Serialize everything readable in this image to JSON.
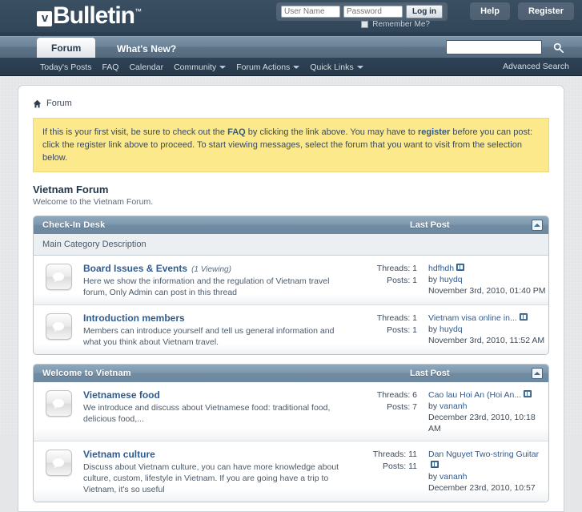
{
  "header": {
    "logo_text": "Bulletin",
    "logo_mark": "v",
    "logo_tm": "™",
    "login": {
      "username_placeholder": "User Name",
      "password_placeholder": "Password",
      "login_button": "Log in",
      "remember_label": "Remember Me?"
    },
    "help_button": "Help",
    "register_button": "Register"
  },
  "nav": {
    "tabs": [
      {
        "label": "Forum",
        "active": true
      },
      {
        "label": "What's New?",
        "active": false
      }
    ],
    "links": [
      {
        "label": "Today's Posts",
        "dropdown": false
      },
      {
        "label": "FAQ",
        "dropdown": false
      },
      {
        "label": "Calendar",
        "dropdown": false
      },
      {
        "label": "Community",
        "dropdown": true
      },
      {
        "label": "Forum Actions",
        "dropdown": true
      },
      {
        "label": "Quick Links",
        "dropdown": true
      }
    ],
    "advanced_search": "Advanced Search",
    "search_value": ""
  },
  "breadcrumb": {
    "label": "Forum"
  },
  "notice": {
    "part1": "If this is your first visit, be sure to check out the ",
    "faq": "FAQ",
    "part2": " by clicking the link above. You may have to ",
    "register": "register",
    "part3": " before you can post: click the register link above to proceed. To start viewing messages, select the forum that you want to visit from the selection below."
  },
  "page_title": "Vietnam Forum",
  "page_subtitle": "Welcome to the Vietnam Forum.",
  "last_post_header": "Last Post",
  "categories": [
    {
      "title": "Check-In Desk",
      "description": "Main Category Description",
      "forums": [
        {
          "name": "Board Issues & Events",
          "viewing": "(1 Viewing)",
          "description": "Here we show the information and the regulation of Vietnam travel forum, Only Admin can post in this thread",
          "threads_label": "Threads: 1",
          "posts_label": "Posts: 1",
          "last_title": "hdfhdh",
          "last_by_prefix": "by ",
          "last_by": "huydq",
          "last_date": "November 3rd, 2010, 01:40 PM"
        },
        {
          "name": "Introduction members",
          "viewing": "",
          "description": "Members can introduce yourself and tell us general information and what you think about Vietnam travel.",
          "threads_label": "Threads: 1",
          "posts_label": "Posts: 1",
          "last_title": "Vietnam visa online in...",
          "last_by_prefix": "by ",
          "last_by": "huydq",
          "last_date": "November 3rd, 2010, 11:52 AM"
        }
      ]
    },
    {
      "title": "Welcome to Vietnam",
      "description": "",
      "forums": [
        {
          "name": "Vietnamese food",
          "viewing": "",
          "description": "We introduce and discuss about Vietnamese food: traditional food, delicious food,...",
          "threads_label": "Threads: 6",
          "posts_label": "Posts: 7",
          "last_title": "Cao lau Hoi An (Hoi An...",
          "last_by_prefix": "by ",
          "last_by": "vananh",
          "last_date": "December 23rd, 2010, 10:18 AM"
        },
        {
          "name": "Vietnam culture",
          "viewing": "",
          "description": "Discuss about Vietnam culture, you can have more knowledge about culture, custom, lifestyle in Vietnam. If you are going have a trip to Vietnam, it's so useful",
          "threads_label": "Threads: 11",
          "posts_label": "Posts: 11",
          "last_title": "Dan Nguyet Two-string Guitar",
          "last_by_prefix": "by ",
          "last_by": "vananh",
          "last_date": "December 23rd, 2010, 10:57"
        }
      ]
    }
  ],
  "colors": {
    "header_dark": "#2b3d50",
    "nav_mid": "#6a8297",
    "link_blue": "#2e5c92",
    "notice_yellow": "#fbe98b",
    "cat_head": "#7d97ad"
  }
}
